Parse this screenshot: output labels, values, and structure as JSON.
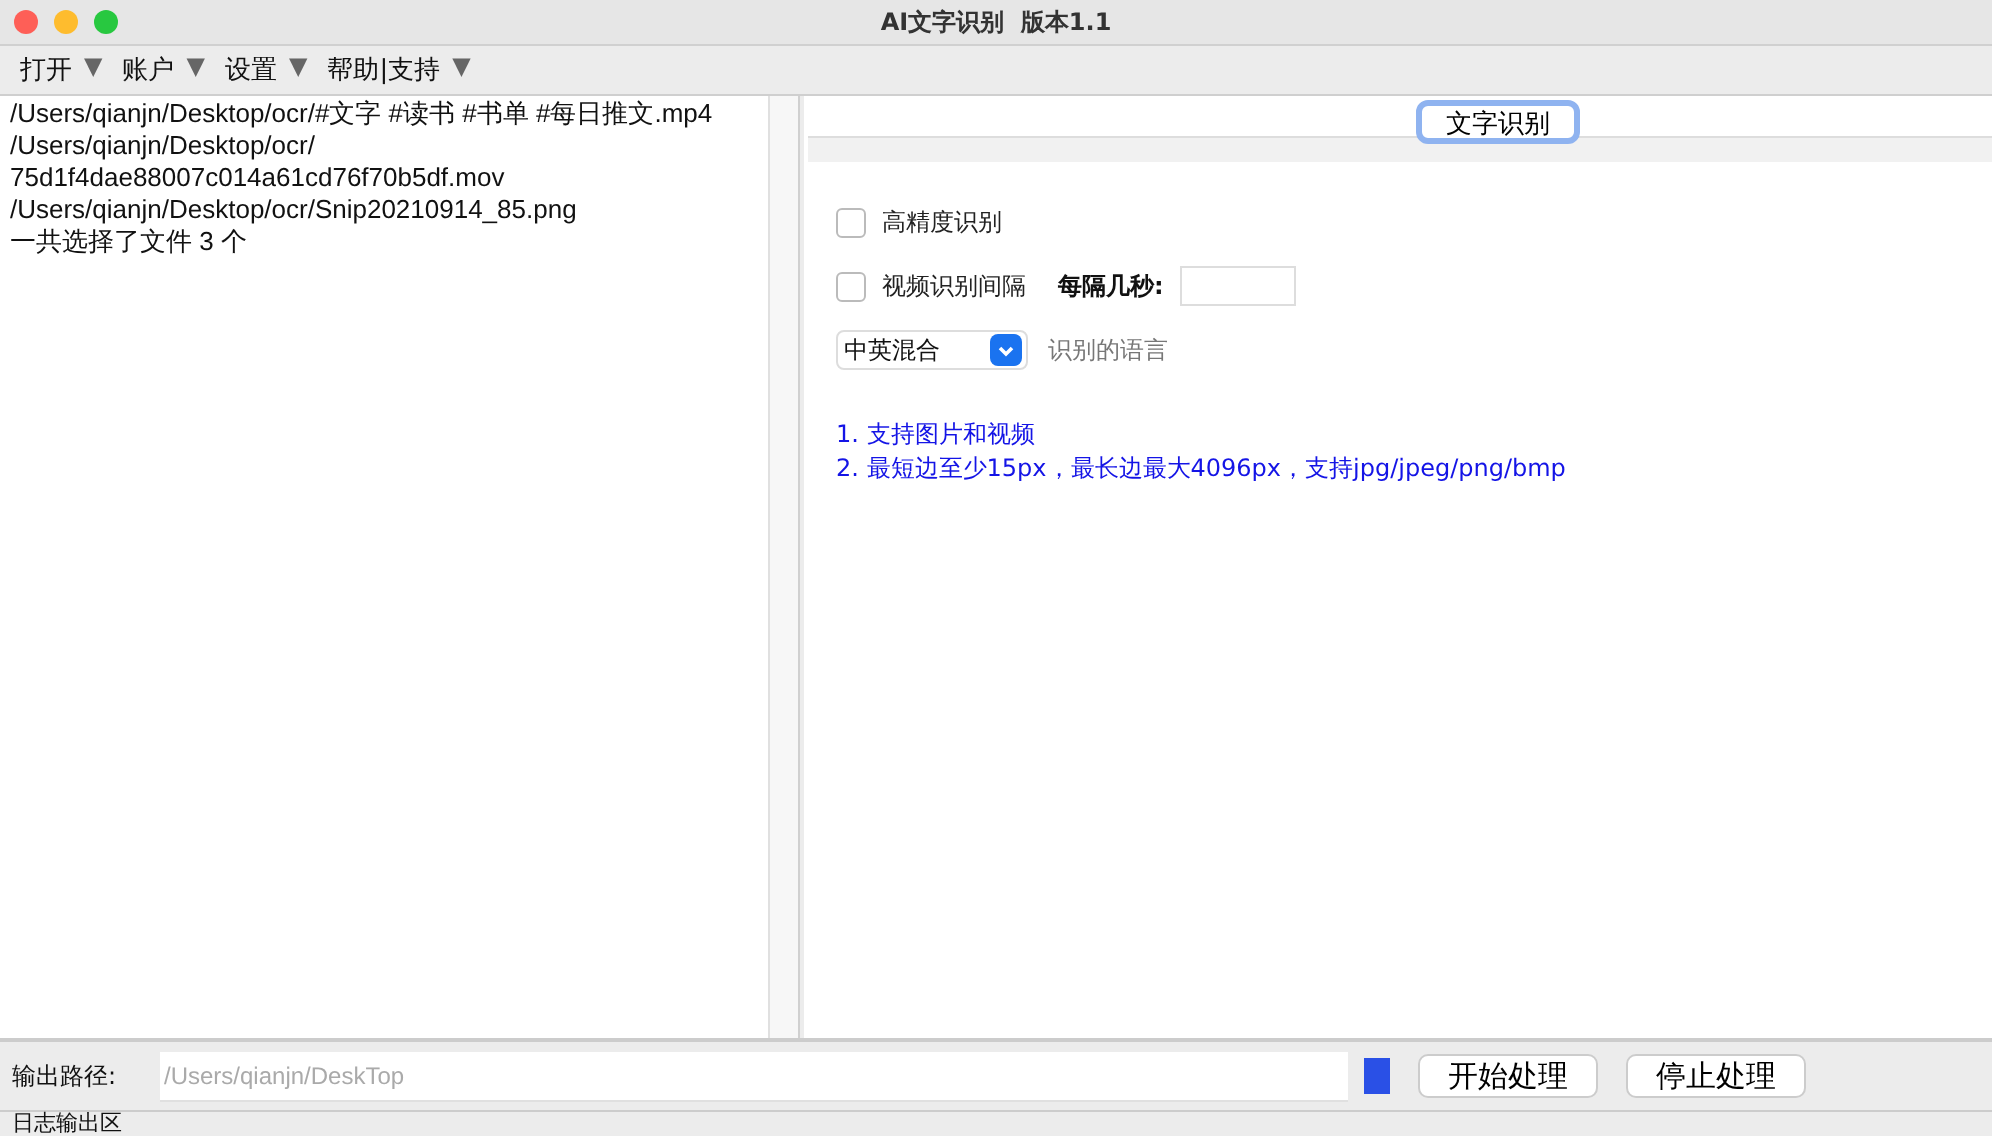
{
  "window": {
    "title": "AI文字识别  版本1.1"
  },
  "menu": [
    {
      "label": "打开",
      "arrow": "▼"
    },
    {
      "label": "账户",
      "arrow": "▼"
    },
    {
      "label": "设置",
      "arrow": "▼"
    },
    {
      "label": "帮助|支持",
      "arrow": "▼"
    }
  ],
  "file_list": {
    "lines": [
      "/Users/qianjn/Desktop/ocr/#文字 #读书 #书单 #每日推文.mp4",
      "/Users/qianjn/Desktop/ocr/",
      "75d1f4dae88007c014a61cd76f70b5df.mov",
      "/Users/qianjn/Desktop/ocr/Snip20210914_85.png",
      "一共选择了文件 3 个"
    ]
  },
  "tabs": [
    {
      "label": "文字识别",
      "selected": true
    }
  ],
  "options": {
    "high_precision": {
      "label": "高精度识别",
      "checked": false
    },
    "video_interval": {
      "label": "视频识别间隔",
      "checked": false
    },
    "seconds": {
      "label": "每隔几秒:"
    },
    "language": {
      "value": "中英混合",
      "label": "识别的语言"
    }
  },
  "notes": [
    "1. 支持图片和视频",
    "2. 最短边至少15px，最长边最大4096px，支持jpg/jpeg/png/bmp"
  ],
  "output": {
    "label": "输出路径:",
    "placeholder": "/Users/qianjn/DeskTop"
  },
  "buttons": [
    "开始处理",
    "停止处理"
  ],
  "log": {
    "label": "日志输出区"
  }
}
